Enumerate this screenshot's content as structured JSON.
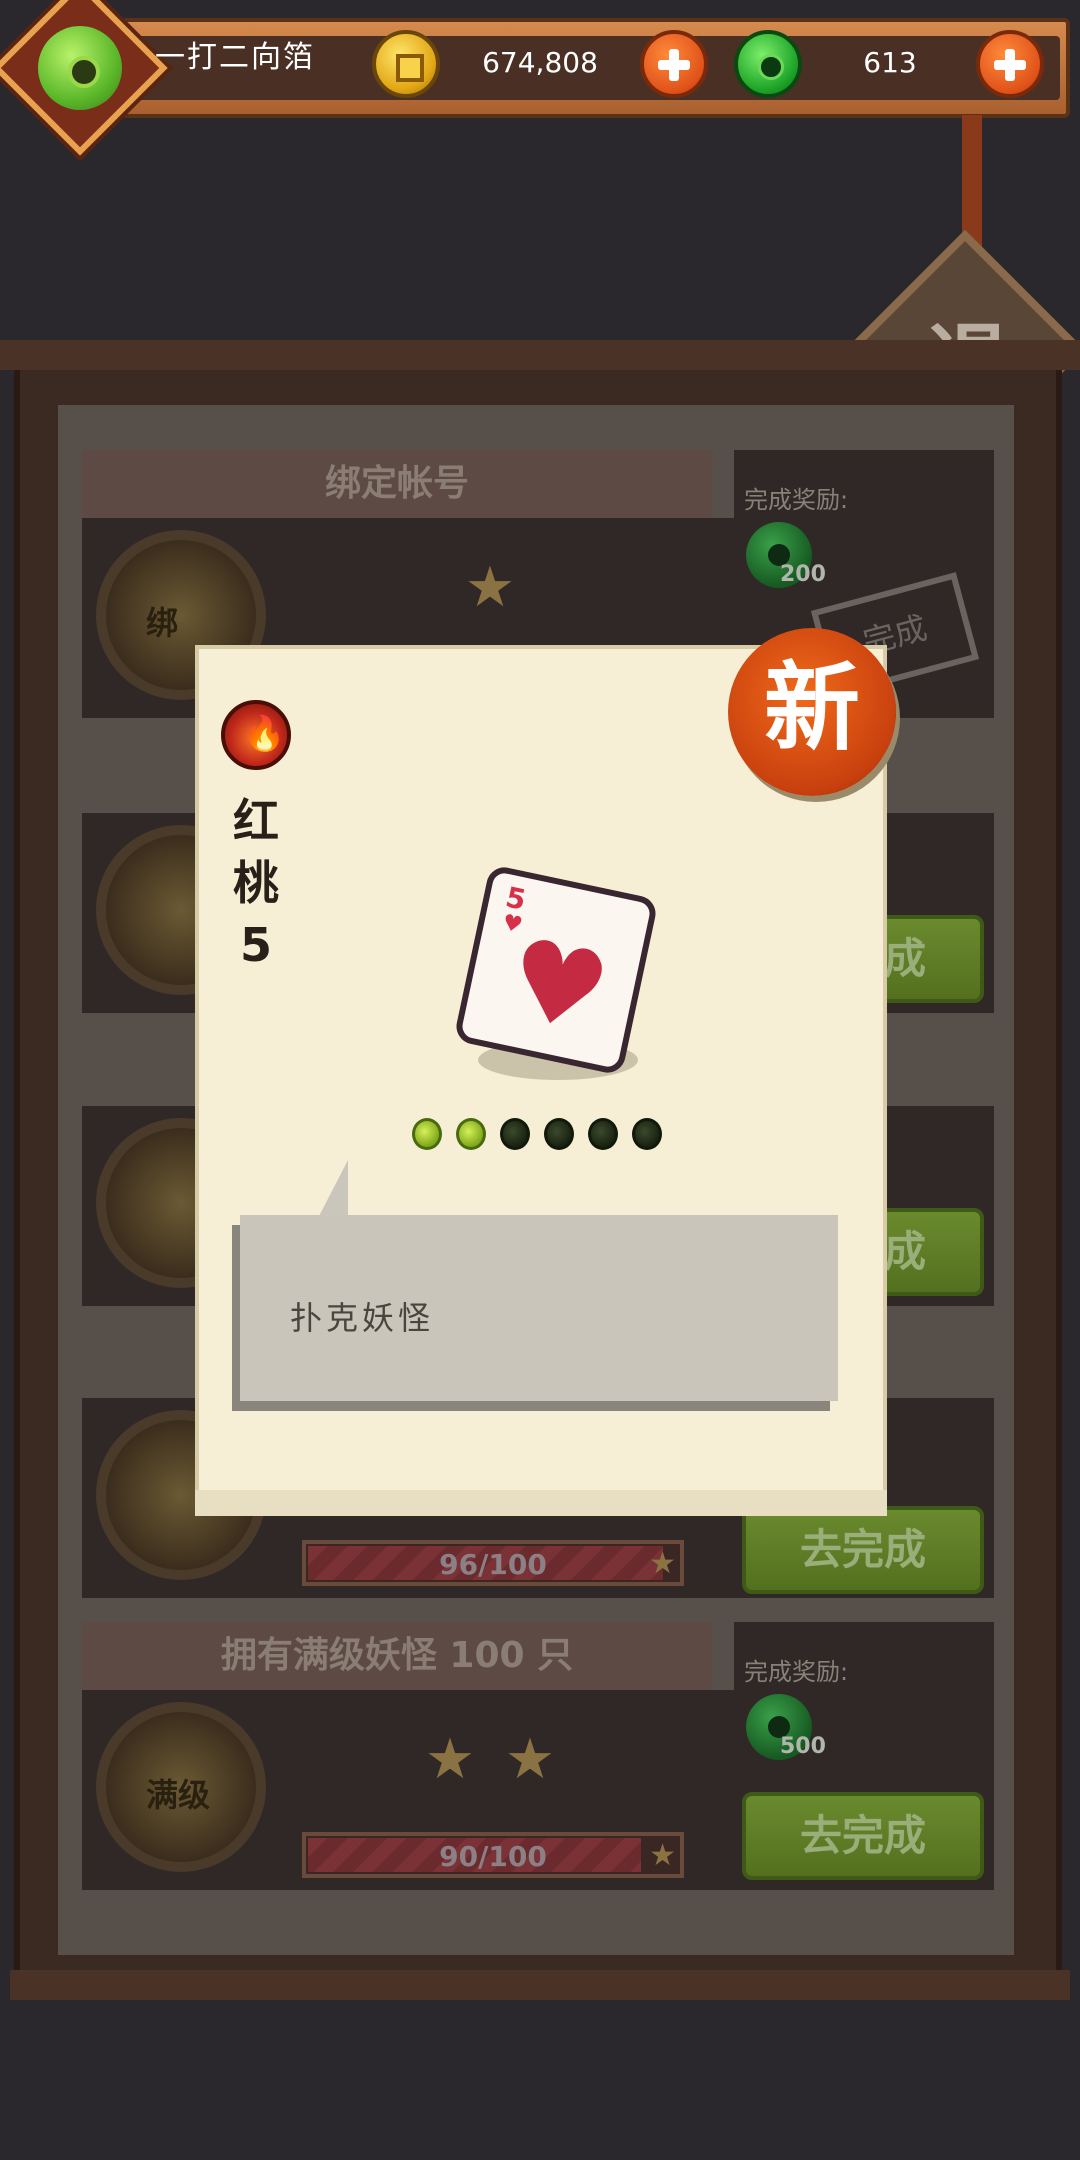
{
  "header": {
    "nickname": "一打二向箔",
    "coins": "674,808",
    "jade": "613"
  },
  "exit_label": "退",
  "tasks": [
    {
      "title": "绑定帐号",
      "reward_label": "完成奖励:",
      "reward_amount": "200",
      "medal_text": "绑",
      "stamp_text": "完成"
    },
    {
      "title": "",
      "button": "去完成"
    },
    {
      "title": "",
      "button": "去完成"
    },
    {
      "title": "",
      "progress_text": "96/100",
      "progress_value": 0.96,
      "button": "去完成"
    },
    {
      "title": "拥有满级妖怪 100 只",
      "reward_label": "完成奖励:",
      "reward_amount": "500",
      "medal_text": "满级",
      "progress_text": "90/100",
      "progress_value": 0.9,
      "button": "去完成"
    }
  ],
  "popup": {
    "card_name": "红桃5",
    "card_rank": "5",
    "new_label": "新",
    "level_filled": 2,
    "level_total": 6,
    "description": "扑克妖怪"
  },
  "colors": {
    "background": "#2a282c",
    "accent_orange": "#e0521a",
    "jade_green": "#1fa52a",
    "heart_red": "#d83048"
  }
}
